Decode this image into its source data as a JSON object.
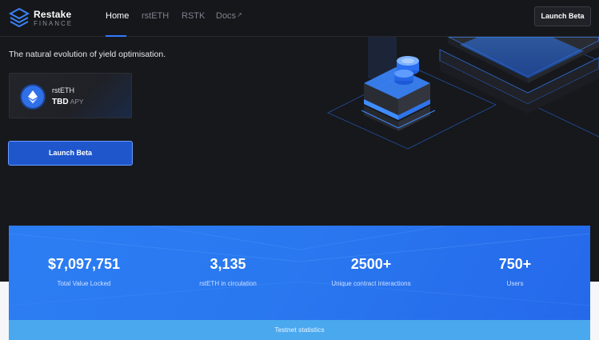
{
  "brand": {
    "name": "Restake",
    "sub": "FINANCE",
    "logo_icon": "layered-stack-logo-icon"
  },
  "nav": {
    "items": [
      {
        "label": "Home",
        "active": true
      },
      {
        "label": "rstETH",
        "active": false
      },
      {
        "label": "RSTK",
        "active": false
      },
      {
        "label": "Docs",
        "active": false,
        "external": true
      }
    ],
    "external_icon": "↗"
  },
  "header": {
    "cta_label": "Launch Beta"
  },
  "hero": {
    "tagline": "The natural evolution of yield optimisation.",
    "apy_card": {
      "token_icon": "rsteth-token-icon",
      "token_name": "rstETH",
      "apy_value": "TBD",
      "apy_suffix": "APY"
    },
    "cta_label": "Launch Beta",
    "art_icon": "isometric-coin-stack-illustration"
  },
  "stats": {
    "items": [
      {
        "value": "$7,097,751",
        "label": "Total Value Locked"
      },
      {
        "value": "3,135",
        "label": "rstETH in circulation"
      },
      {
        "value": "2500+",
        "label": "Unique contract interactions"
      },
      {
        "value": "750+",
        "label": "Users"
      }
    ],
    "footer_label": "Testnet statistics"
  },
  "colors": {
    "background": "#17181c",
    "accent": "#2f7bff",
    "button_primary": "#1f56cc",
    "stats_band": "#2a78f0",
    "testnet_bar": "#4aa8ee"
  }
}
